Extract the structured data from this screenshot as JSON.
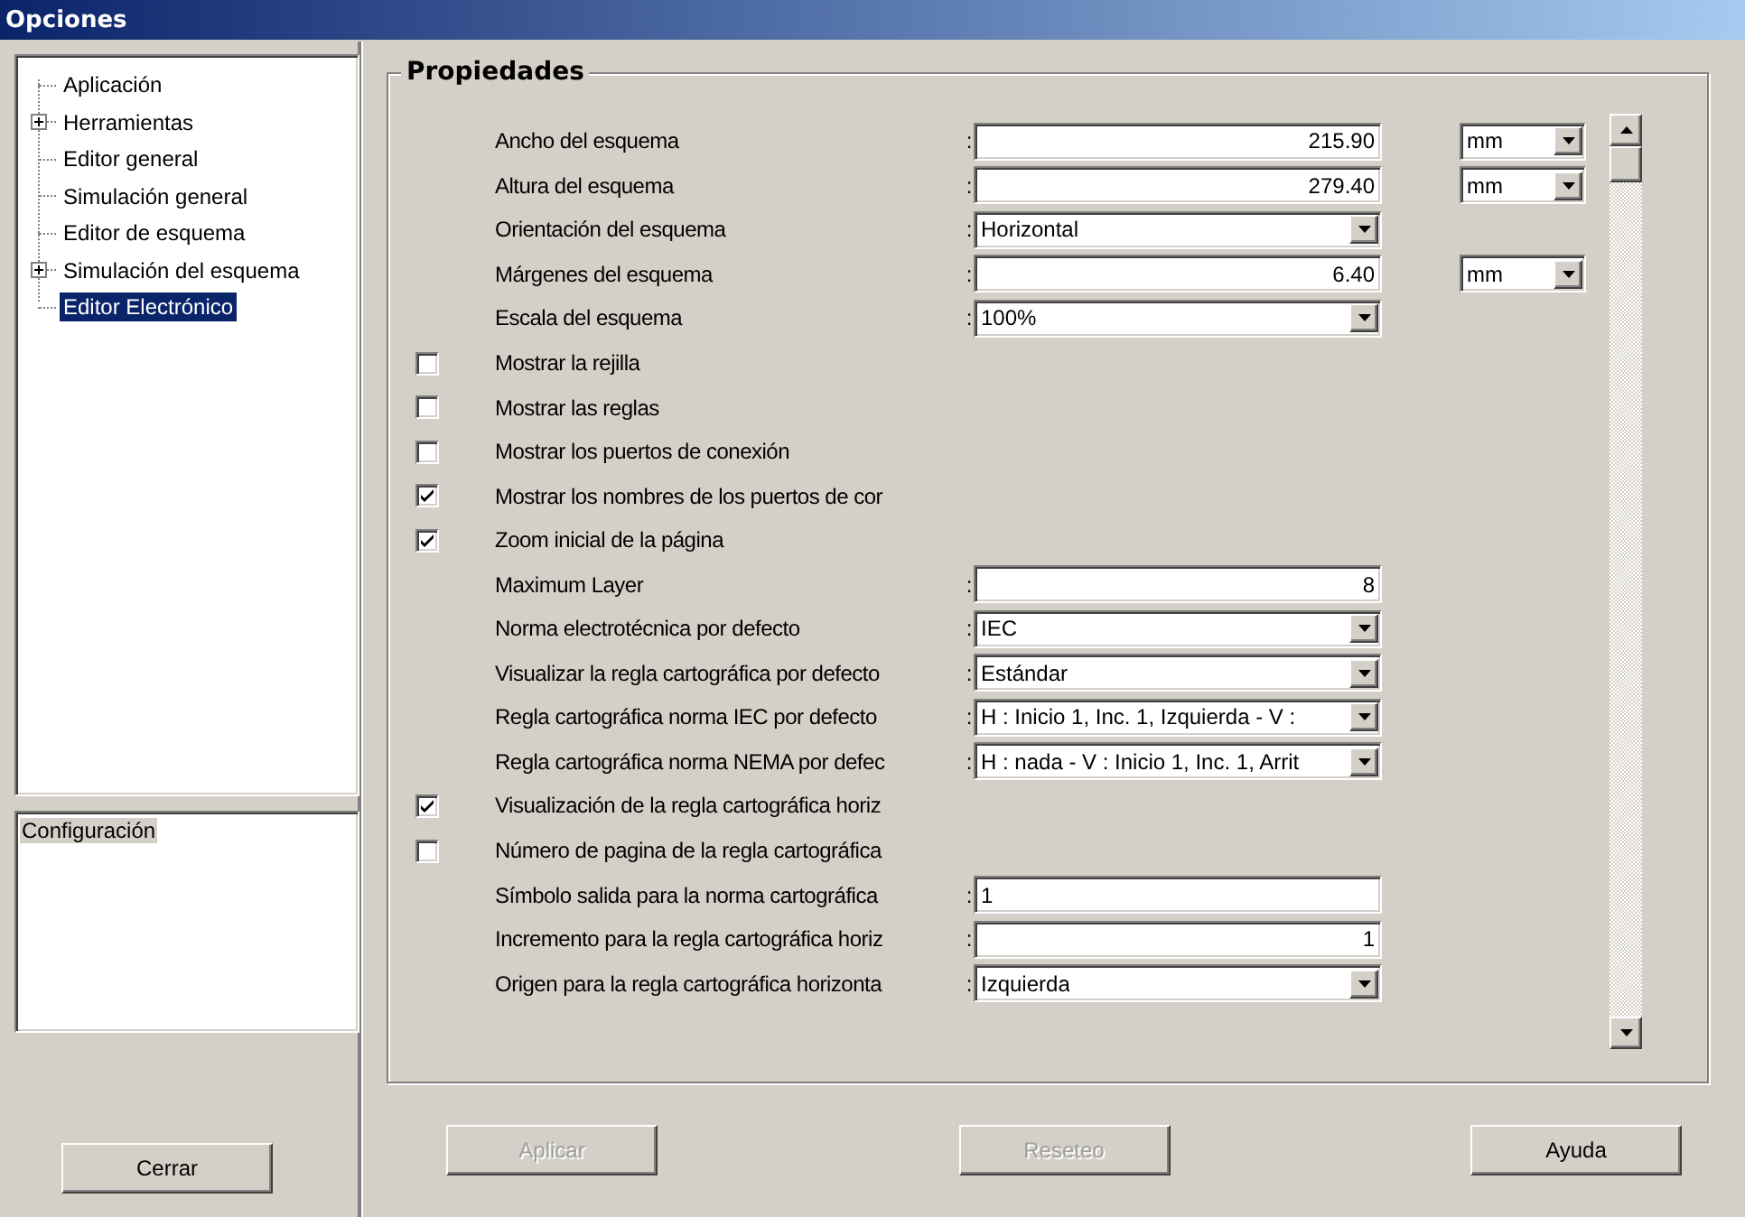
{
  "window": {
    "title": "Opciones"
  },
  "tree": [
    {
      "label": "Aplicación",
      "expander": false,
      "selected": false
    },
    {
      "label": "Herramientas",
      "expander": true,
      "selected": false
    },
    {
      "label": "Editor general",
      "expander": false,
      "selected": false
    },
    {
      "label": "Simulación general",
      "expander": false,
      "selected": false
    },
    {
      "label": "Editor de esquema",
      "expander": false,
      "selected": false
    },
    {
      "label": "Simulación del esquema",
      "expander": true,
      "selected": false
    },
    {
      "label": "Editor Electrónico",
      "expander": false,
      "selected": true
    }
  ],
  "config_list": {
    "items": [
      "Configuración"
    ]
  },
  "close_button": {
    "label": "Cerrar",
    "disabled": false
  },
  "properties": {
    "title": "Propiedades",
    "rows": [
      {
        "kind": "number",
        "label": "Ancho del esquema",
        "colon": ":",
        "value": "215.90",
        "unit": "mm"
      },
      {
        "kind": "number",
        "label": "Altura del esquema",
        "colon": ":",
        "value": "279.40",
        "unit": "mm"
      },
      {
        "kind": "select",
        "label": "Orientación del esquema",
        "colon": ":",
        "value": "Horizontal"
      },
      {
        "kind": "number",
        "label": "Márgenes del esquema",
        "colon": ":",
        "value": "6.40",
        "unit": "mm"
      },
      {
        "kind": "select",
        "label": "Escala del esquema",
        "colon": ":",
        "value": "100%"
      },
      {
        "kind": "checkbox",
        "label": "Mostrar la rejilla",
        "checked": false
      },
      {
        "kind": "checkbox",
        "label": "Mostrar las reglas",
        "checked": false
      },
      {
        "kind": "checkbox",
        "label": "Mostrar los puertos de conexión",
        "checked": false
      },
      {
        "kind": "checkbox",
        "label": "Mostrar los nombres de los puertos de cor",
        "checked": true
      },
      {
        "kind": "checkbox",
        "label": "Zoom inicial de la página",
        "checked": true
      },
      {
        "kind": "number",
        "label": "Maximum Layer",
        "colon": ":",
        "value": "8"
      },
      {
        "kind": "select",
        "label": "Norma electrotécnica por defecto",
        "colon": ":",
        "value": "IEC"
      },
      {
        "kind": "select",
        "label": "Visualizar la regla cartográfica por defecto",
        "colon": ":",
        "value": "Estándar"
      },
      {
        "kind": "select",
        "label": "Regla cartográfica norma IEC por defecto",
        "colon": ":",
        "value": "H : Inicio 1, Inc. 1, Izquierda - V :"
      },
      {
        "kind": "select",
        "label": "Regla cartográfica norma NEMA por defec",
        "colon": ":",
        "value": "H : nada - V : Inicio 1, Inc. 1, Arrit"
      },
      {
        "kind": "checkbox",
        "label": "Visualización de la regla cartográfica horiz",
        "checked": true
      },
      {
        "kind": "checkbox",
        "label": "Número de pagina de la regla cartográfica",
        "checked": false
      },
      {
        "kind": "text",
        "label": "Símbolo salida para la norma cartográfica",
        "colon": ":",
        "value": "1"
      },
      {
        "kind": "number",
        "label": "Incremento para la regla cartográfica horiz",
        "colon": ":",
        "value": "1"
      },
      {
        "kind": "select",
        "label": "Origen para la regla cartográfica horizonta",
        "colon": ":",
        "value": "Izquierda"
      }
    ]
  },
  "buttons": [
    {
      "label": "Aplicar",
      "disabled": true
    },
    {
      "label": "Reseteo",
      "disabled": true
    },
    {
      "label": "Ayuda",
      "disabled": false
    }
  ]
}
